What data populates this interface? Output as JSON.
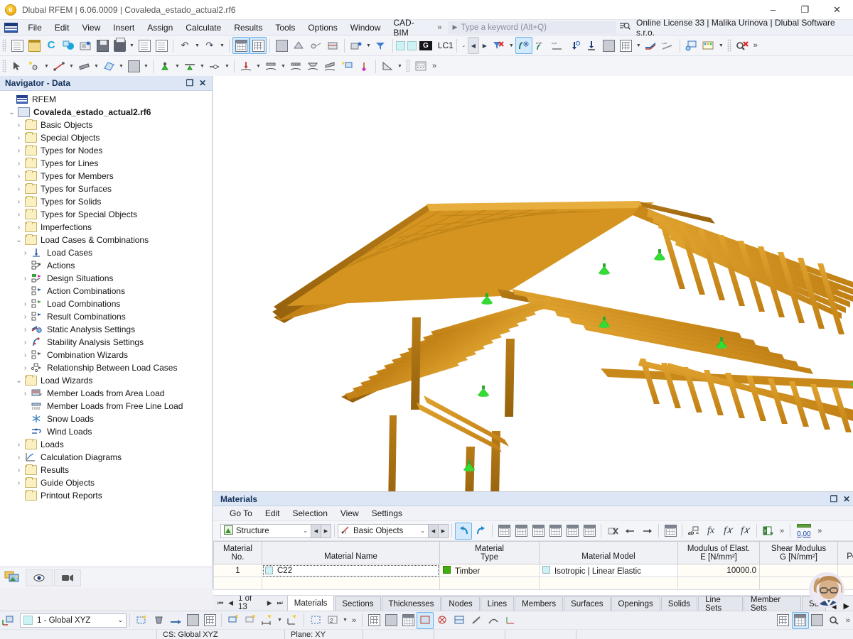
{
  "titlebar": {
    "app_icon": "rfem-logo-icon",
    "title": "Dlubal RFEM | 6.06.0009 | Covaleda_estado_actual2.rf6",
    "minimize": "–",
    "maximize": "❐",
    "close": "✕"
  },
  "menubar": {
    "items": [
      {
        "label": "File"
      },
      {
        "label": "Edit"
      },
      {
        "label": "View"
      },
      {
        "label": "Insert"
      },
      {
        "label": "Assign"
      },
      {
        "label": "Calculate"
      },
      {
        "label": "Results"
      },
      {
        "label": "Tools"
      },
      {
        "label": "Options"
      },
      {
        "label": "Window"
      },
      {
        "label": "CAD-BIM"
      }
    ],
    "overflow": "»",
    "play": "▶",
    "search_placeholder": "Type a keyword (Alt+Q)",
    "license": "Online License 33 | Malika Urinova | Dlubal Software s.r.o."
  },
  "toolbar_main": {
    "load_case_label": "LC1",
    "load_case_tag": "G",
    "overflow": "»"
  },
  "navigator": {
    "title": "Navigator - Data",
    "float_btn": "❐",
    "close_btn": "✕",
    "root": "RFEM",
    "file": "Covaleda_estado_actual2.rf6",
    "items": [
      {
        "label": "Basic Objects",
        "indent": 2,
        "twisty": "›",
        "icon": "folder-icon"
      },
      {
        "label": "Special Objects",
        "indent": 2,
        "twisty": "›",
        "icon": "folder-icon"
      },
      {
        "label": "Types for Nodes",
        "indent": 2,
        "twisty": "›",
        "icon": "folder-icon"
      },
      {
        "label": "Types for Lines",
        "indent": 2,
        "twisty": "›",
        "icon": "folder-icon"
      },
      {
        "label": "Types for Members",
        "indent": 2,
        "twisty": "›",
        "icon": "folder-icon"
      },
      {
        "label": "Types for Surfaces",
        "indent": 2,
        "twisty": "›",
        "icon": "folder-icon"
      },
      {
        "label": "Types for Solids",
        "indent": 2,
        "twisty": "›",
        "icon": "folder-icon"
      },
      {
        "label": "Types for Special Objects",
        "indent": 2,
        "twisty": "›",
        "icon": "folder-icon"
      },
      {
        "label": "Imperfections",
        "indent": 2,
        "twisty": "›",
        "icon": "folder-icon"
      },
      {
        "label": "Load Cases & Combinations",
        "indent": 2,
        "twisty": "⌄",
        "icon": "folder-open-icon"
      },
      {
        "label": "Load Cases",
        "indent": 3,
        "twisty": "›",
        "icon": "load-case-icon"
      },
      {
        "label": "Actions",
        "indent": 3,
        "twisty": "",
        "icon": "actions-icon"
      },
      {
        "label": "Design Situations",
        "indent": 3,
        "twisty": "›",
        "icon": "design-situations-icon"
      },
      {
        "label": "Action Combinations",
        "indent": 3,
        "twisty": "",
        "icon": "action-combinations-icon"
      },
      {
        "label": "Load Combinations",
        "indent": 3,
        "twisty": "›",
        "icon": "load-combinations-icon"
      },
      {
        "label": "Result Combinations",
        "indent": 3,
        "twisty": "›",
        "icon": "result-combinations-icon"
      },
      {
        "label": "Static Analysis Settings",
        "indent": 3,
        "twisty": "›",
        "icon": "static-analysis-icon"
      },
      {
        "label": "Stability Analysis Settings",
        "indent": 3,
        "twisty": "›",
        "icon": "stability-analysis-icon"
      },
      {
        "label": "Combination Wizards",
        "indent": 3,
        "twisty": "›",
        "icon": "combination-wizards-icon"
      },
      {
        "label": "Relationship Between Load Cases",
        "indent": 3,
        "twisty": "›",
        "icon": "relationship-icon"
      },
      {
        "label": "Load Wizards",
        "indent": 2,
        "twisty": "⌄",
        "icon": "folder-open-icon"
      },
      {
        "label": "Member Loads from Area Load",
        "indent": 3,
        "twisty": "›",
        "icon": "member-loads-area-icon"
      },
      {
        "label": "Member Loads from Free Line Load",
        "indent": 3,
        "twisty": "",
        "icon": "member-loads-line-icon"
      },
      {
        "label": "Snow Loads",
        "indent": 3,
        "twisty": "",
        "icon": "snow-icon"
      },
      {
        "label": "Wind Loads",
        "indent": 3,
        "twisty": "",
        "icon": "wind-icon"
      },
      {
        "label": "Loads",
        "indent": 2,
        "twisty": "›",
        "icon": "folder-icon"
      },
      {
        "label": "Calculation Diagrams",
        "indent": 2,
        "twisty": "›",
        "icon": "diagram-icon"
      },
      {
        "label": "Results",
        "indent": 2,
        "twisty": "›",
        "icon": "folder-icon"
      },
      {
        "label": "Guide Objects",
        "indent": 2,
        "twisty": "›",
        "icon": "folder-icon"
      },
      {
        "label": "Printout Reports",
        "indent": 2,
        "twisty": "",
        "icon": "folder-icon"
      }
    ]
  },
  "materials_panel": {
    "title": "Materials",
    "float_btn": "❐",
    "close_btn": "✕",
    "menu": [
      "Go To",
      "Edit",
      "Selection",
      "View",
      "Settings"
    ],
    "combo_structure": "Structure",
    "combo_objects": "Basic Objects",
    "overflow": "»",
    "decimals_label": "0,00",
    "columns": [
      {
        "line1": "Material",
        "line2": "No."
      },
      {
        "line1": "",
        "line2": "Material Name"
      },
      {
        "line1": "Material",
        "line2": "Type"
      },
      {
        "line1": "",
        "line2": "Material Model"
      },
      {
        "line1": "Modulus of Elast.",
        "line2": "E [N/mm²]"
      },
      {
        "line1": "Shear Modulus",
        "line2": "G [N/mm²]"
      },
      {
        "line1": "",
        "line2": "Poi"
      }
    ],
    "rows": [
      {
        "no": "1",
        "name": "C22",
        "name_swatch": "#ccf2f5",
        "type": "Timber",
        "type_swatch": "#3fae0f",
        "model": "Isotropic | Linear Elastic",
        "model_swatch": "#ccf2f5",
        "E": "10000.0",
        "G": "",
        "poisson": ""
      }
    ],
    "pager": {
      "first": "⏮",
      "prev": "◀",
      "text": "1 of 13",
      "next": "▶",
      "last": "⏭"
    },
    "tabs": [
      {
        "label": "Materials",
        "active": true
      },
      {
        "label": "Sections",
        "active": false
      },
      {
        "label": "Thicknesses",
        "active": false
      },
      {
        "label": "Nodes",
        "active": false
      },
      {
        "label": "Lines",
        "active": false
      },
      {
        "label": "Members",
        "active": false
      },
      {
        "label": "Surfaces",
        "active": false
      },
      {
        "label": "Openings",
        "active": false
      },
      {
        "label": "Solids",
        "active": false
      },
      {
        "label": "Line Sets",
        "active": false
      },
      {
        "label": "Member Sets",
        "active": false
      },
      {
        "label": "Su",
        "active": false
      }
    ],
    "tab_scroll_prev": "◀",
    "tab_scroll_next": "▶"
  },
  "bottombar": {
    "coord_system": "1 - Global XYZ",
    "coord_swatch": "#ccf2f5",
    "overflow": "»"
  },
  "statusbar": {
    "cs": "CS: Global XYZ",
    "plane": "Plane: XY"
  },
  "viewport": {
    "model_name": "timber-roof-structure-3d-model",
    "member_color": "#d2901f",
    "member_color_dark": "#a06a12",
    "support_color": "#26d726",
    "background": "#ffffff"
  }
}
